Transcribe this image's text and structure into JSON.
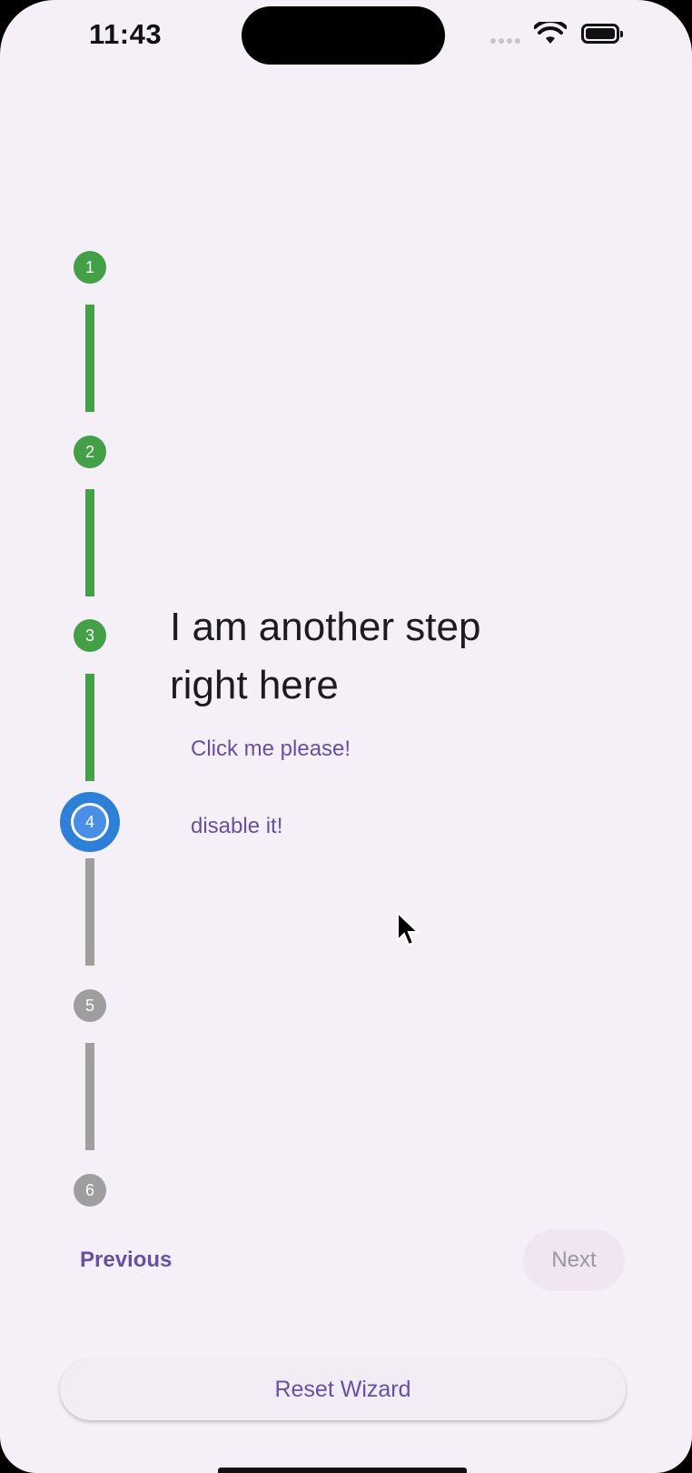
{
  "status_bar": {
    "time": "11:43"
  },
  "stepper": {
    "steps": [
      {
        "number": "1",
        "state": "done"
      },
      {
        "number": "2",
        "state": "done"
      },
      {
        "number": "3",
        "state": "done"
      },
      {
        "number": "4",
        "state": "active"
      },
      {
        "number": "5",
        "state": "todo"
      },
      {
        "number": "6",
        "state": "todo"
      }
    ]
  },
  "content": {
    "title": "I am another step right here",
    "click_label": "Click me please!",
    "disable_label": "disable it!"
  },
  "navigation": {
    "previous_label": "Previous",
    "next_label": "Next"
  },
  "reset": {
    "label": "Reset Wizard"
  },
  "colors": {
    "background": "#f5f0f8",
    "done": "#43a047",
    "active": "#2e7fd8",
    "todo": "#9e9e9e",
    "accent": "#6750a4"
  }
}
